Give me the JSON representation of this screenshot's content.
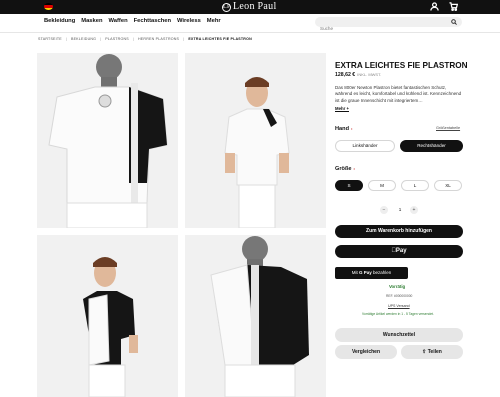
{
  "header": {
    "brand": "Leon Paul",
    "brand_mark": "LP",
    "flag_colors": [
      "#000000",
      "#dd0000",
      "#ffce00"
    ],
    "icons": [
      "user-icon",
      "cart-icon"
    ]
  },
  "nav": {
    "items": [
      "Bekleidung",
      "Masken",
      "Waffen",
      "Fechttaschen",
      "Wireless",
      "Mehr"
    ],
    "search_placeholder": "Suche"
  },
  "breadcrumb": {
    "items": [
      "STARTSEITE",
      "BEKLEIDUNG",
      "PLASTRONS",
      "HERREN PLASTRONS",
      "EXTRA LEICHTES FIE PLASTRON"
    ]
  },
  "product": {
    "title": "EXTRA LEICHTES FIE PLASTRON",
    "price": "128,62 €",
    "tax_note": "INKL. MWST.",
    "description": "Das 800er Newton Plastron bietet fantastischen Schutz, während es leicht, komfortabel und kühlend ist. Kennzeichnend ist die graue Innenschicht mit integriertem…",
    "more_label": "Mehr +",
    "hand": {
      "label": "Hand",
      "required_mark": "•",
      "size_guide": "Größentabelle",
      "options": [
        "Linkshänder",
        "Rechtshänder"
      ],
      "selected": "Rechtshänder"
    },
    "size": {
      "label": "Größe",
      "required_mark": "•",
      "options": [
        "S",
        "M",
        "L",
        "XL"
      ],
      "selected": "S"
    },
    "quantity": {
      "minus": "−",
      "value": "1",
      "plus": "+"
    },
    "add_to_cart": "Zum Warenkorb hinzufügen",
    "apple_pay": "Pay",
    "gpay_prefix": "Mit",
    "gpay_brand": "G Pay",
    "gpay_suffix": "bezahlen",
    "stock": "Vorrätig",
    "article_no": "REF. #000000000",
    "shipping_link": "UPS Versand",
    "delivery": "Vorrätige Artikel werden in 1 - 5 Tagen versendet.",
    "wishlist": "Wunschzettel",
    "compare": "Vergleichen",
    "share": "Teilen"
  }
}
